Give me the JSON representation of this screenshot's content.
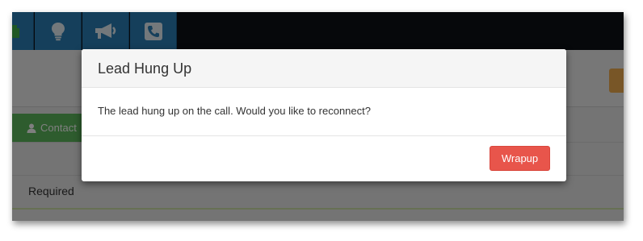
{
  "nav": {
    "items": [
      {
        "icon": "green-icon",
        "color": "#3fae49"
      },
      {
        "icon": "lightbulb-icon"
      },
      {
        "icon": "megaphone-icon"
      },
      {
        "icon": "phone-icon"
      }
    ],
    "accent": "#2a7fb6"
  },
  "page": {
    "contact_label": "Contact",
    "required_label": "Required"
  },
  "modal": {
    "title": "Lead Hung Up",
    "message": "The lead hung up on the call. Would you like to reconnect?",
    "wrapup_label": "Wrapup",
    "wrapup_color": "#e8554b"
  }
}
